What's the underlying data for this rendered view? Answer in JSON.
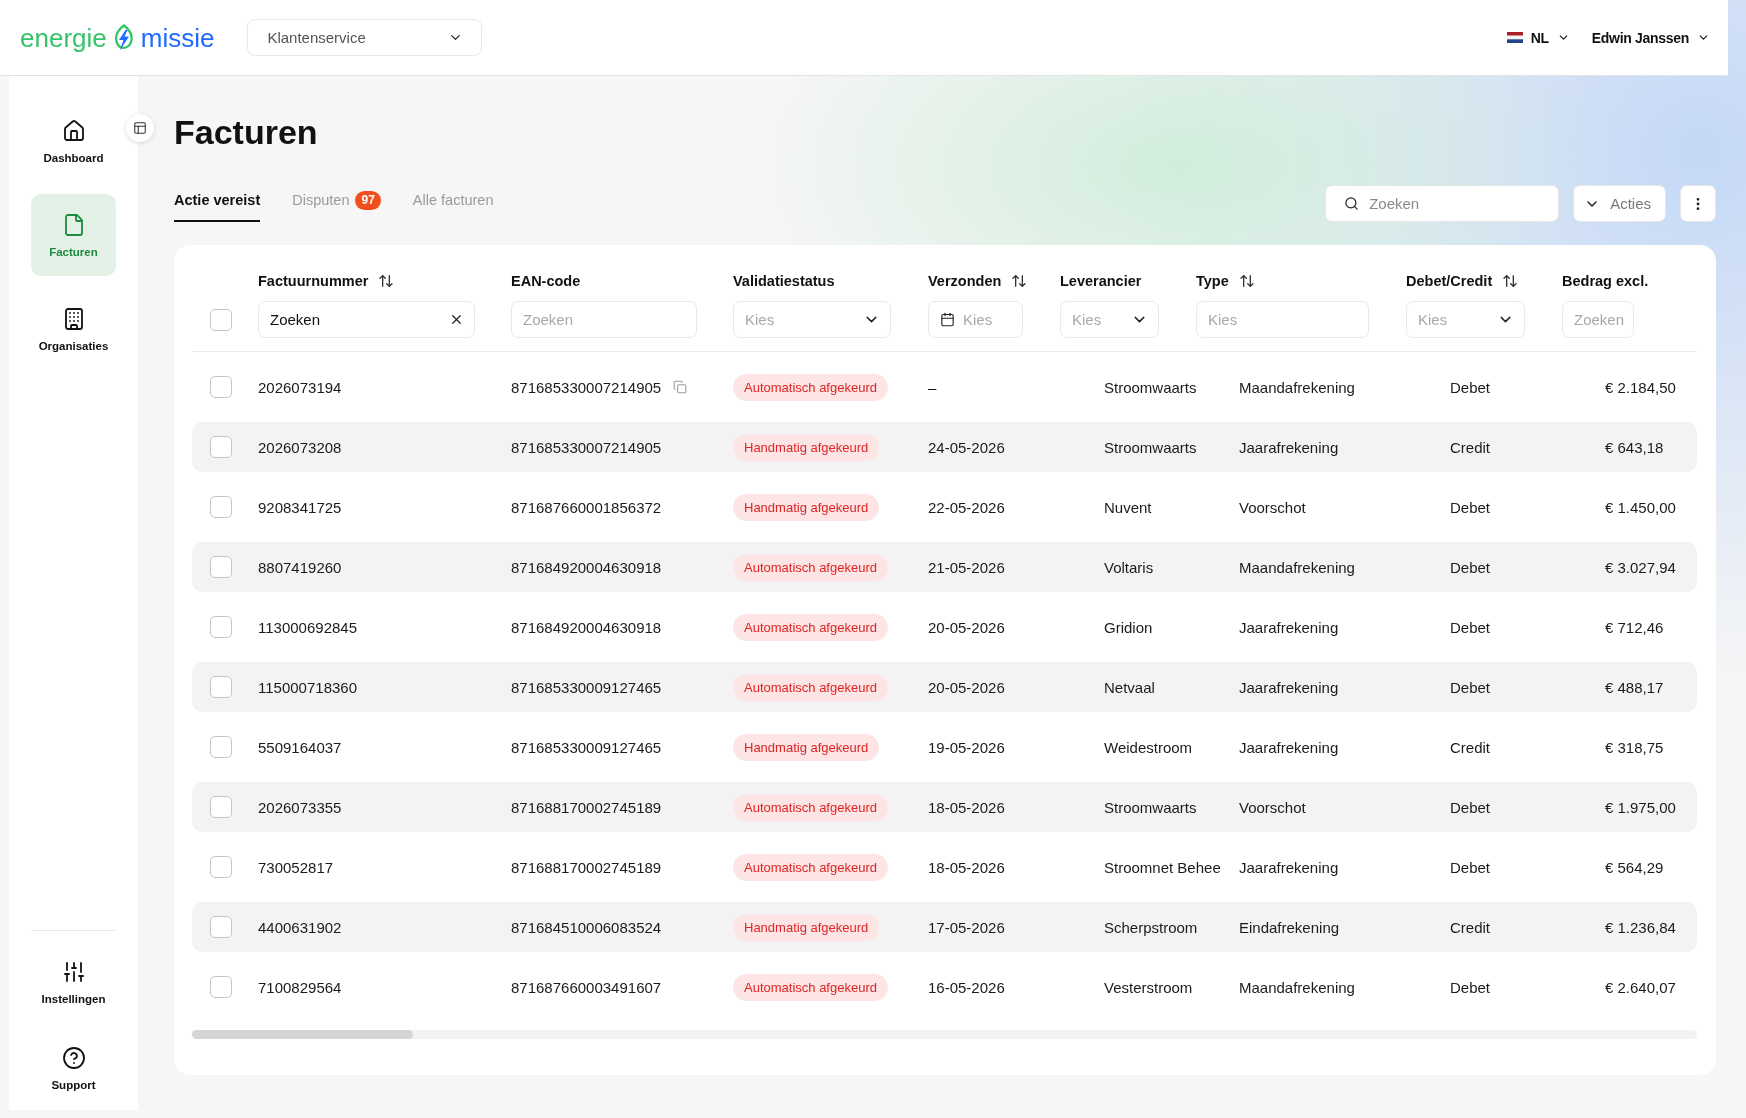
{
  "header": {
    "logo": {
      "word_1": "energie",
      "word_2": "missie"
    },
    "context_select": {
      "value": "Klantenservice"
    },
    "language": {
      "code": "NL"
    },
    "user": {
      "name": "Edwin Janssen"
    }
  },
  "sidebar": {
    "items": [
      {
        "label": "Dashboard",
        "selected": false
      },
      {
        "label": "Facturen",
        "selected": true
      },
      {
        "label": "Organisaties",
        "selected": false
      }
    ],
    "bottom_items": [
      {
        "label": "Instellingen",
        "selected": false
      },
      {
        "label": "Support",
        "selected": false
      }
    ]
  },
  "page": {
    "title": "Facturen"
  },
  "tabs": [
    {
      "label": "Actie vereist",
      "selected": true
    },
    {
      "label": "Disputen",
      "selected": false,
      "badge": "97"
    },
    {
      "label": "Alle facturen",
      "selected": false
    }
  ],
  "toolbar": {
    "search": {
      "placeholder": "Zoeken"
    },
    "actions_button": {
      "label": "Acties"
    }
  },
  "table": {
    "select_all": {
      "checked": false
    },
    "columns": [
      {
        "label": "Factuurnummer",
        "sortable": true,
        "filter": {
          "kind": "text",
          "value": "Zoeken"
        }
      },
      {
        "label": "EAN-code",
        "sortable": false,
        "filter": {
          "kind": "text",
          "placeholder": "Zoeken"
        }
      },
      {
        "label": "Validatiestatus",
        "sortable": false,
        "filter": {
          "kind": "select",
          "placeholder": "Kies"
        }
      },
      {
        "label": "Verzonden",
        "sortable": true,
        "filter": {
          "kind": "date",
          "placeholder": "Kies"
        }
      },
      {
        "label": "Leverancier",
        "sortable": false,
        "filter": {
          "kind": "select",
          "placeholder": "Kies"
        }
      },
      {
        "label": "Type",
        "sortable": true,
        "filter": {
          "kind": "text",
          "placeholder": "Kies"
        }
      },
      {
        "label": "Debet/Credit",
        "sortable": true,
        "filter": {
          "kind": "select",
          "placeholder": "Kies"
        }
      },
      {
        "label": "Bedrag excl.",
        "sortable": false,
        "filter": {
          "kind": "text",
          "placeholder": "Zoeken"
        }
      }
    ],
    "rows": [
      {
        "checked": false,
        "factuurnummer": "2026073194",
        "ean_code": "871685330007214905",
        "copy_button": true,
        "status": "Automatisch afgekeurd",
        "verzonden": "–",
        "leverancier": "Stroomwaarts",
        "type": "Maandafrekening",
        "debet_credit": "Debet",
        "bedrag": "€ 2.184,50"
      },
      {
        "checked": false,
        "factuurnummer": "2026073208",
        "ean_code": "871685330007214905",
        "copy_button": false,
        "status": "Handmatig afgekeurd",
        "verzonden": "24-05-2026",
        "leverancier": "Stroomwaarts",
        "type": "Jaarafrekening",
        "debet_credit": "Credit",
        "bedrag": "€ 643,18"
      },
      {
        "checked": false,
        "factuurnummer": "9208341725",
        "ean_code": "871687660001856372",
        "copy_button": false,
        "status": "Handmatig afgekeurd",
        "verzonden": "22-05-2026",
        "leverancier": "Nuvent",
        "type": "Voorschot",
        "debet_credit": "Debet",
        "bedrag": "€ 1.450,00"
      },
      {
        "checked": false,
        "factuurnummer": "8807419260",
        "ean_code": "871684920004630918",
        "copy_button": false,
        "status": "Automatisch afgekeurd",
        "verzonden": "21-05-2026",
        "leverancier": "Voltaris",
        "type": "Maandafrekening",
        "debet_credit": "Debet",
        "bedrag": "€ 3.027,94"
      },
      {
        "checked": false,
        "factuurnummer": "113000692845",
        "ean_code": "871684920004630918",
        "copy_button": false,
        "status": "Automatisch afgekeurd",
        "verzonden": "20-05-2026",
        "leverancier": "Gridion",
        "type": "Jaarafrekening",
        "debet_credit": "Debet",
        "bedrag": "€ 712,46"
      },
      {
        "checked": false,
        "factuurnummer": "115000718360",
        "ean_code": "871685330009127465",
        "copy_button": false,
        "status": "Automatisch afgekeurd",
        "verzonden": "20-05-2026",
        "leverancier": "Netvaal",
        "type": "Jaarafrekening",
        "debet_credit": "Debet",
        "bedrag": "€ 488,17"
      },
      {
        "checked": false,
        "factuurnummer": "5509164037",
        "ean_code": "871685330009127465",
        "copy_button": false,
        "status": "Handmatig afgekeurd",
        "verzonden": "19-05-2026",
        "leverancier": "Weidestroom",
        "type": "Jaarafrekening",
        "debet_credit": "Credit",
        "bedrag": "€ 318,75"
      },
      {
        "checked": false,
        "factuurnummer": "2026073355",
        "ean_code": "871688170002745189",
        "copy_button": false,
        "status": "Automatisch afgekeurd",
        "verzonden": "18-05-2026",
        "leverancier": "Stroomwaarts",
        "type": "Voorschot",
        "debet_credit": "Debet",
        "bedrag": "€ 1.975,00"
      },
      {
        "checked": false,
        "factuurnummer": "730052817",
        "ean_code": "871688170002745189",
        "copy_button": false,
        "status": "Automatisch afgekeurd",
        "verzonden": "18-05-2026",
        "leverancier": "Stroomnet Behee",
        "type": "Jaarafrekening",
        "debet_credit": "Debet",
        "bedrag": "€ 564,29"
      },
      {
        "checked": false,
        "factuurnummer": "4400631902",
        "ean_code": "871684510006083524",
        "copy_button": false,
        "status": "Handmatig afgekeurd",
        "verzonden": "17-05-2026",
        "leverancier": "Scherpstroom",
        "type": "Eindafrekening",
        "debet_credit": "Credit",
        "bedrag": "€ 1.236,84"
      },
      {
        "checked": false,
        "factuurnummer": "7100829564",
        "ean_code": "871687660003491607",
        "copy_button": false,
        "status": "Automatisch afgekeurd",
        "verzonden": "16-05-2026",
        "leverancier": "Vesterstroom",
        "type": "Maandafrekening",
        "debet_credit": "Debet",
        "bedrag": "€ 2.640,07"
      }
    ]
  }
}
